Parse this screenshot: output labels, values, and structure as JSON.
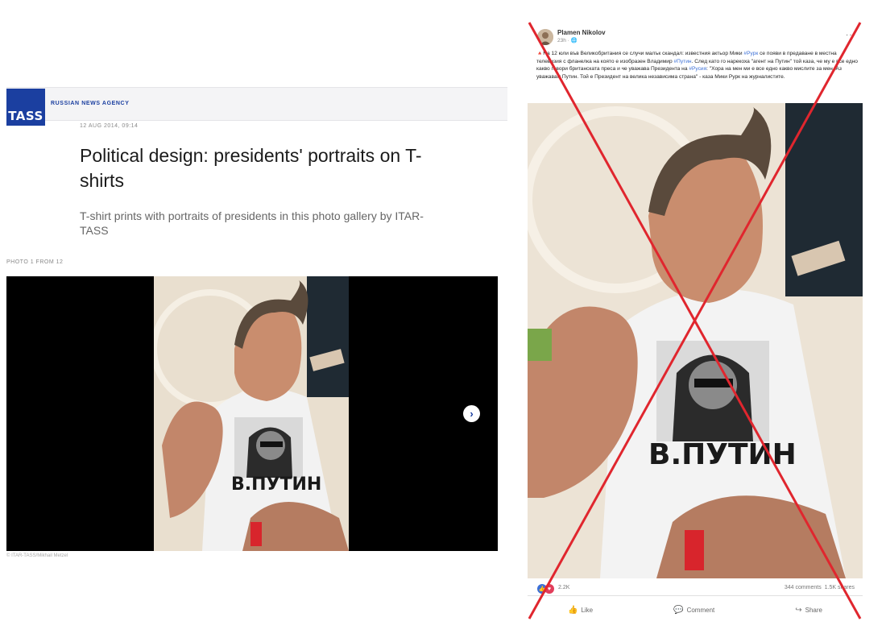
{
  "tass": {
    "logo": "TASS",
    "tagline": "RUSSIAN NEWS AGENCY",
    "date": "12 AUG 2014, 09:14",
    "title": "Political design: presidents' portraits on T-shirts",
    "lead": "T-shirt prints with portraits of presidents in this photo gallery by ITAR-TASS",
    "photo_counter": "PHOTO 1 FROM 12",
    "next_icon": "chevron-right-icon",
    "credit": "© ITAR-TASS/Mikhail Metzel",
    "accent": "#1b3fa0"
  },
  "fb": {
    "author": "Plamen Nikolov",
    "meta": "23h · 🌐",
    "more": "···",
    "text_parts": [
      "🔺На 12 юли във Великобритания се случи малък скандал: известния актьор Мики ",
      "#Рурк",
      " се появи в предаване в местна телевизия с фланелка на която е изобразен Владимир ",
      "#Путин",
      ". След като го нарекоха \"агент на Путин\" той каза, че му е все едно какво говори британската преса и че уважава Президента на ",
      "#Русия",
      ": \"Хора на мен ми е все едно какво мислите за мен. Аз уважавам Путин. Той е Президент на велика независима страна\" - каза Мики Рурк на журналистите."
    ],
    "shirt_text": "В.ПУТИН",
    "reactions_count": "2.2K",
    "comments": "344 comments",
    "shares": "1.5K shares",
    "actions": {
      "like": "Like",
      "comment": "Comment",
      "share": "Share"
    },
    "link_color": "#3b6fd6"
  },
  "overlay": {
    "cross_color": "#e0262e"
  }
}
